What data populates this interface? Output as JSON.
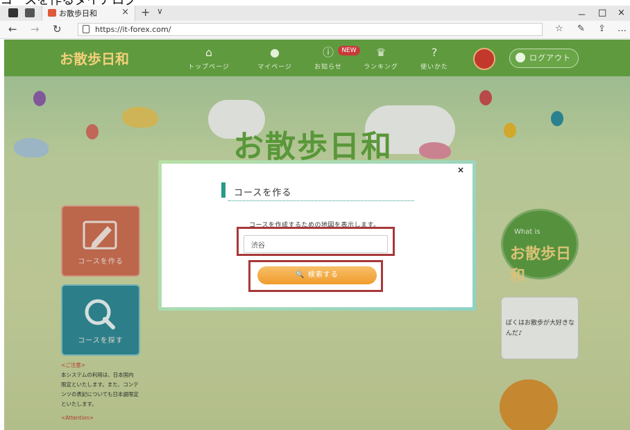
{
  "caption": "コースを作るダイアログ",
  "browser": {
    "tab_title": "お散歩日和",
    "tab_close": "×",
    "new_tab": "+",
    "tab_menu": "∨",
    "url": "https://it-forex.com/",
    "back": "←",
    "forward": "→",
    "refresh": "↻",
    "win_minimize": "－",
    "win_maximize": "□",
    "win_close": "×",
    "toolbar_icons": [
      "☆",
      "✎",
      "⇪",
      "…"
    ]
  },
  "site": {
    "logo": "お散歩日和",
    "nav": [
      {
        "icon": "home-icon",
        "glyph": "⌂",
        "label": "トップページ"
      },
      {
        "icon": "user-icon",
        "glyph": "●",
        "label": "マイページ"
      },
      {
        "icon": "info-icon",
        "glyph": "ⓘ",
        "label": "お知らせ"
      },
      {
        "icon": "crown-icon",
        "glyph": "♛",
        "label": "ランキング"
      },
      {
        "icon": "help-icon",
        "glyph": "?",
        "label": "使いかた"
      }
    ],
    "new_badge": "NEW",
    "logout": "ログアウト",
    "hero_logo": "お散歩日和",
    "side_buttons": {
      "create": "コースを作る",
      "search": "コースを探す"
    },
    "notice": {
      "heading": "<ご注意>",
      "body": "本システムの利用は、日本国内限定といたします。また、コンテンツの表記についても日本語限定といたします。",
      "attention": "<Attention>"
    },
    "whatis": {
      "label": "What is",
      "logo": "お散歩日和"
    },
    "bubble": "ぼくはお散歩が大好きなんだ♪"
  },
  "modal": {
    "close": "×",
    "title": "コースを作る",
    "description": "コースを作成するための地図を表示します。",
    "search_value": "渋谷",
    "search_button": "🔍 検索する"
  },
  "colors": {
    "header_green": "#5f9a3f",
    "accent_teal": "#2a9a8a",
    "button_orange": "#f09b2c",
    "highlight_red": "#a8383a"
  }
}
